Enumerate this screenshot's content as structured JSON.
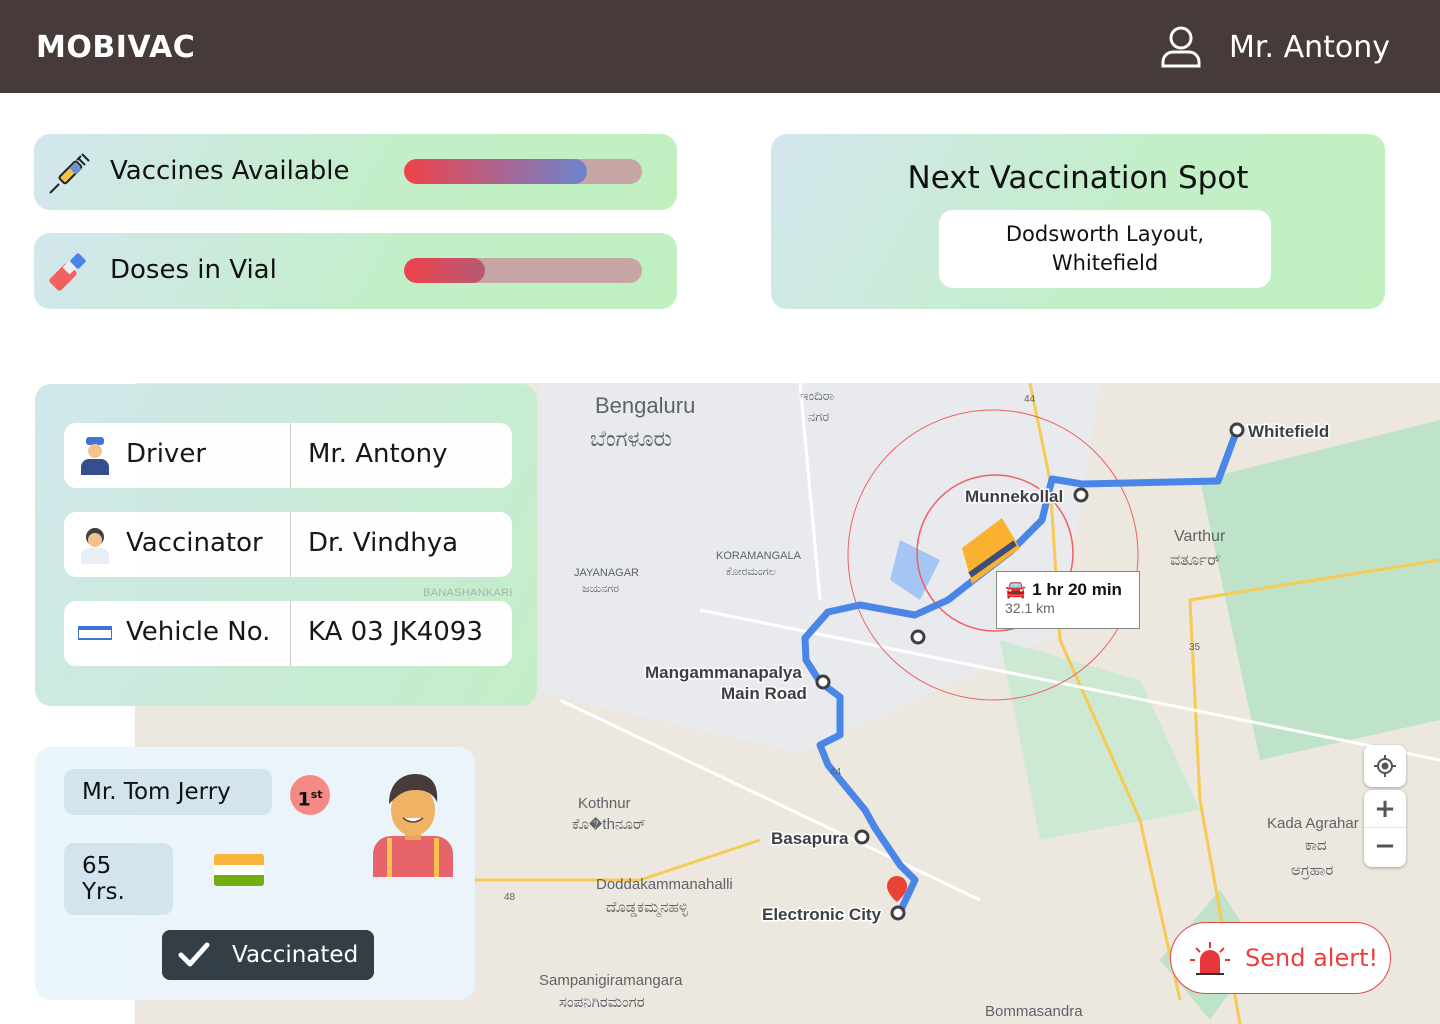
{
  "header": {
    "brand": "MOBIVAC",
    "user_name": "Mr. Antony",
    "user_icon": "user-icon"
  },
  "stats": [
    {
      "label": "Vaccines Available",
      "icon": "syringe-icon",
      "progress": 0.77,
      "colors": [
        "#f0424a",
        "#6d84cf"
      ]
    },
    {
      "label": "Doses in Vial",
      "icon": "vial-icon",
      "progress": 0.34,
      "colors": [
        "#f0424a",
        "#b55a75"
      ]
    }
  ],
  "next_spot": {
    "title": "Next Vaccination Spot",
    "line1": "Dodsworth Layout,",
    "line2": "Whitefield"
  },
  "crew": [
    {
      "key": "Driver",
      "value": "Mr. Antony",
      "icon": "driver-icon"
    },
    {
      "key": "Vaccinator",
      "value": "Dr. Vindhya",
      "icon": "doctor-icon"
    },
    {
      "key": "Vehicle No.",
      "value": "KA 03 JK4093",
      "icon": "license-plate-icon"
    }
  ],
  "patient": {
    "name": "Mr. Tom Jerry",
    "dose": "1",
    "dose_suffix": "st",
    "age": "65 Yrs.",
    "status": "Vaccinated",
    "flag": "india-flag-icon"
  },
  "map": {
    "labels": {
      "bengaluru": "Bengaluru",
      "bengaluru_kn": "ಬೆಂಗಳೂರು",
      "indira": "ಇಂದಿರಾ",
      "nagar": "ನಗರ",
      "whitefield": "Whitefield",
      "munnekollal": "Munnekollal",
      "varthur": "Varthur",
      "varthur_kn": "ವರ್ತೂರ್",
      "koramangala": "KORAMANGALA",
      "koramangala_kn": "ಕೋರಮಂಗಲ",
      "jayanagar": "JAYANAGAR",
      "jayanagar_kn": "ಜಯನಗರ",
      "banashankari": "BANASHANKARI",
      "mangammanapalya": "Mangammanapalya",
      "main_road": "Main Road",
      "kothnur": "Kothnur",
      "kothnur_kn": "ಕೊ�thನೂರ್",
      "basapura": "Basapura",
      "doddakammanahalli": "Doddakammanahalli",
      "doddakammanahalli_kn": "ದೊಡ್ಡಕಮ್ಮನಹಳ್ಳಿ",
      "electronic_city": "Electronic City",
      "kada": "Kada Agrahar",
      "kada_kn1": "ಕಾದ",
      "kada_kn2": "ಅಗ್ರಹಾರ",
      "sampangi": "Sampanigiramangara",
      "sampangi_kn": "ಸಂಪನಿಗಿರಮಂಗರ",
      "bommasandra": "Bommasandra",
      "nh44": "44",
      "nh48": "48",
      "nh35": "35"
    },
    "eta": {
      "time": "1 hr 20 min",
      "distance": "32.1 km"
    },
    "route_color": "#4a86e8"
  },
  "controls": {
    "locate": "locate-icon",
    "zoom_in": "+",
    "zoom_out": "−"
  },
  "alert": {
    "label": "Send alert!"
  }
}
